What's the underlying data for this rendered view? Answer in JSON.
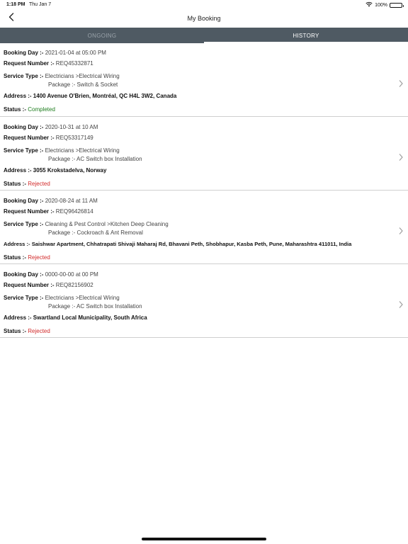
{
  "status_bar": {
    "time": "1:18 PM",
    "date": "Thu Jan 7",
    "battery": "100%"
  },
  "nav": {
    "title": "My Booking"
  },
  "tabs": [
    {
      "label": "ONGOING",
      "active": false
    },
    {
      "label": "HISTORY",
      "active": true
    }
  ],
  "labels": {
    "booking_day": "Booking Day :-",
    "request_number": "Request Number :-",
    "service_type": "Service Type :-",
    "address": "Address :-",
    "status": "Status :-"
  },
  "bookings": [
    {
      "booking_day": "2021-01-04 at 05:00 PM",
      "request_number": "REQ45332871",
      "service_type": "Electricians >Electrical Wiring",
      "package": "Package :- Switch & Socket",
      "address": "1400 Avenue O'Brien, Montréal, QC H4L 3W2, Canada",
      "status": "Completed"
    },
    {
      "booking_day": "2020-10-31 at 10 AM",
      "request_number": "REQ53317149",
      "service_type": "Electricians >Electrical Wiring",
      "package": "Package :- AC Switch box Installation",
      "address": "3055 Krokstadelva, Norway",
      "status": "Rejected"
    },
    {
      "booking_day": "2020-08-24 at 11 AM",
      "request_number": "REQ96426814",
      "service_type": "Cleaning & Pest Control >Kitchen Deep Cleaning",
      "package": "Package :- Cockroach & Ant Removal",
      "address": "Saishwar Apartment, Chhatrapati Shivaji Maharaj Rd, Bhavani Peth, Shobhapur, Kasba Peth, Pune, Maharashtra 411011, India",
      "status": "Rejected"
    },
    {
      "booking_day": "0000-00-00 at 00 PM",
      "request_number": "REQ82156902",
      "service_type": "Electricians >Electrical Wiring",
      "package": "Package :- AC Switch box Installation",
      "address": "Swartland Local Municipality, South Africa",
      "status": "Rejected"
    }
  ],
  "colors": {
    "tab_bar": "#4f5a63",
    "status_completed": "#1e7d1e",
    "status_rejected": "#d22a2a"
  },
  "icons": {
    "back": "chevron-left-icon",
    "row_chevron": "chevron-right-icon",
    "wifi": "wifi-icon",
    "battery": "battery-icon"
  }
}
